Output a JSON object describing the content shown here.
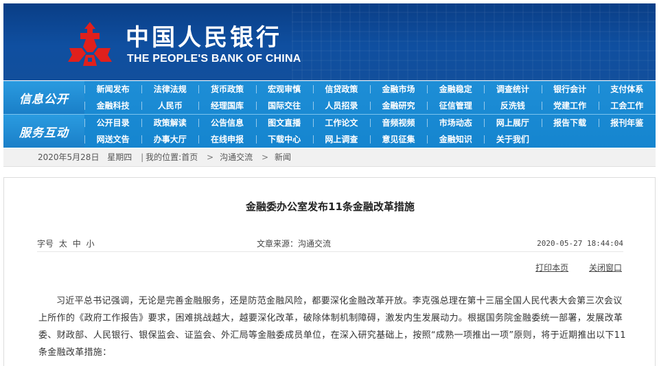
{
  "header": {
    "logo_cn": "中国人民银行",
    "logo_en": "THE PEOPLE'S BANK OF CHINA"
  },
  "nav": {
    "section1_label": "信息公开",
    "section2_label": "服务互动",
    "section1_rows": [
      [
        "新闻发布",
        "法律法规",
        "货币政策",
        "宏观审慎",
        "信贷政策",
        "金融市场",
        "金融稳定",
        "调查统计",
        "银行会计",
        "支付体系"
      ],
      [
        "金融科技",
        "人民币",
        "经理国库",
        "国际交往",
        "人员招录",
        "金融研究",
        "征信管理",
        "反洗钱",
        "党建工作",
        "工会工作"
      ]
    ],
    "section2_rows": [
      [
        "公开目录",
        "政策解读",
        "公告信息",
        "图文直播",
        "工作论文",
        "音频视频",
        "市场动态",
        "网上展厅",
        "报告下载",
        "报刊年鉴"
      ],
      [
        "网送文告",
        "办事大厅",
        "在线申报",
        "下载中心",
        "网上调查",
        "意见征集",
        "金融知识",
        "关于我们"
      ]
    ]
  },
  "breadcrumb": {
    "date": "2020年5月28日",
    "weekday": "星期四",
    "location_label": "我的位置:首页",
    "items": [
      "沟通交流",
      "新闻"
    ]
  },
  "article": {
    "title": "金融委办公室发布11条金融改革措施",
    "font_size_label": "字号",
    "font_sizes": [
      "太",
      "中",
      "小"
    ],
    "source": "文章来源：沟通交流",
    "datetime": "2020-05-27 18:44:04",
    "print_label": "打印本页",
    "close_label": "关闭窗口",
    "body": "习近平总书记强调，无论是完善金融服务，还是防范金融风险，都要深化金融改革开放。李克强总理在第十三届全国人民代表大会第三次会议上所作的《政府工作报告》要求，困难挑战越大，越要深化改革，破除体制机制障碍，激发内生发展动力。根据国务院金融委统一部署，发展改革委、财政部、人民银行、银保监会、证监会、外汇局等金融委成员单位，在深入研究基础上，按照“成熟一项推出一项”原则，将于近期推出以下11条金融改革措施："
  },
  "colors": {
    "banner": "#0f4fa0",
    "nav": "#1a8ad3",
    "logo_red": "#e0201c"
  }
}
